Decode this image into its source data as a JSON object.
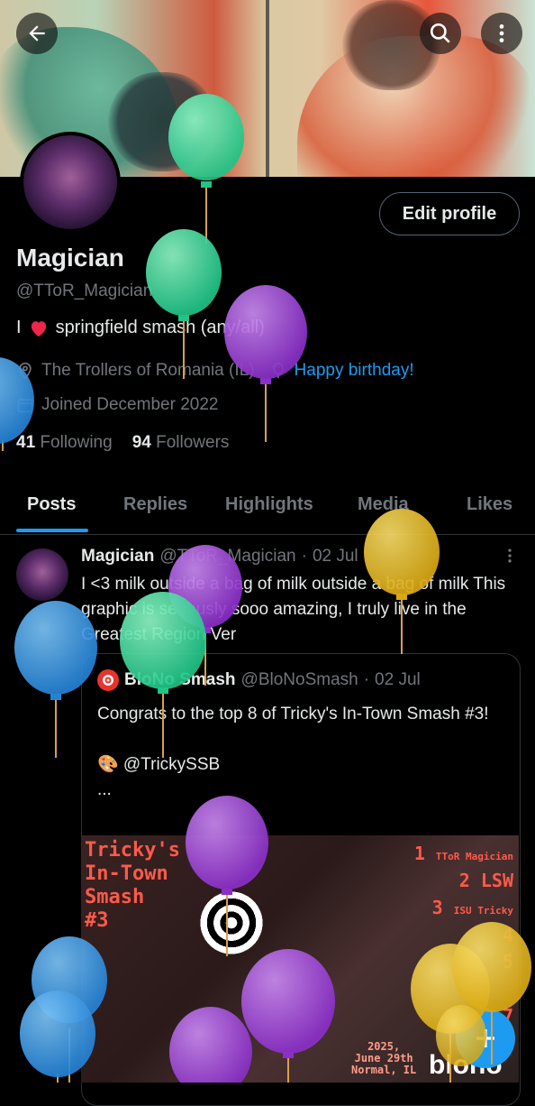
{
  "header": {
    "back_icon": "arrow-left-icon",
    "search_icon": "search-icon",
    "more_icon": "more-vertical-icon"
  },
  "profile": {
    "edit_label": "Edit profile",
    "name": "Magician",
    "handle": "@TToR_Magician",
    "bio_prefix": "I",
    "bio_emoji": "heart-icon",
    "bio_suffix": "springfield smash (any/all)",
    "location": "The Trollers of Romania (IL)",
    "birthday": "Happy birthday!",
    "joined": "Joined December 2022",
    "following_count": "41",
    "following_label": "Following",
    "followers_count": "94",
    "followers_label": "Followers"
  },
  "tabs": [
    "Posts",
    "Replies",
    "Highlights",
    "Media",
    "Likes"
  ],
  "active_tab": "Posts",
  "tweet": {
    "author": "Magician",
    "handle": "@TToR_Magician",
    "dot": "·",
    "date": "02 Jul",
    "text": "I <3 milk outside a bag of milk outside a bag of milk This graphic is seriously sooo amazing, I truly live in the Greatest Region Ver"
  },
  "quote": {
    "author": "BloNo Smash",
    "handle": "@BloNoSmash",
    "dot": "·",
    "date": "02 Jul",
    "text": "Congrats to the top 8 of Tricky's In-Town Smash #3!\n\n🎨 @TrickySSB\n..."
  },
  "poster": {
    "title": "Tricky's\nIn-Town\nSmash\n#3",
    "ranks": [
      {
        "n": "1",
        "name": "TToR Magician"
      },
      {
        "n": "2",
        "name": "LSW"
      },
      {
        "n": "3",
        "name": "ISU Tricky"
      },
      {
        "n": "4",
        "name": ""
      },
      {
        "n": "5",
        "name": ""
      },
      {
        "n": "7",
        "name": ""
      }
    ],
    "date": "2025,\nJune 29th\nNormal, IL",
    "logo": "blono"
  },
  "colors": {
    "accent": "#1d9bf0",
    "text": "#e7e9ea",
    "muted": "#71767b",
    "border": "#2f3336",
    "background": "#000000"
  }
}
